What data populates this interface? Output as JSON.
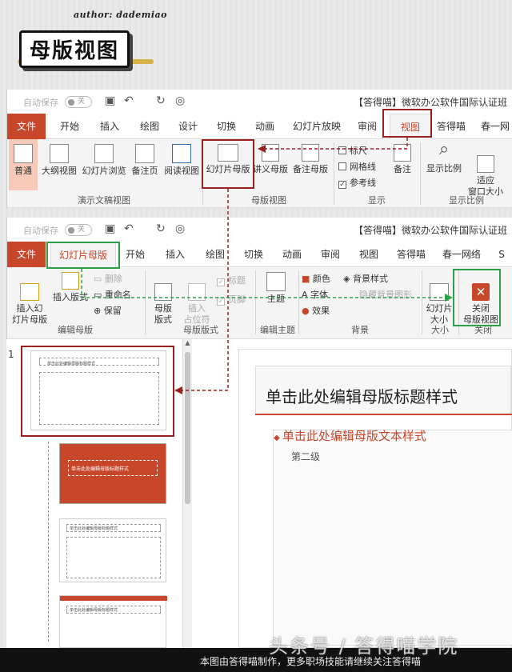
{
  "header": {
    "author": "author: dademiao",
    "title": "母版视图"
  },
  "win1": {
    "autosave": "自动保存",
    "toggle": "关",
    "title": "【答得喵】微软办公软件国际认证班",
    "tabs": [
      "文件",
      "开始",
      "插入",
      "绘图",
      "设计",
      "切换",
      "动画",
      "幻灯片放映",
      "审阅",
      "视图",
      "答得喵",
      "春一网"
    ],
    "buttons": [
      "普通",
      "大纲视图",
      "幻灯片浏览",
      "备注页",
      "阅读视图",
      "幻灯片母版",
      "讲义母版",
      "备注母版",
      "备注",
      "显示比例",
      "适应\n窗口大小"
    ],
    "checks": [
      "标尺",
      "网格线",
      "参考线"
    ],
    "groups": [
      "演示文稿视图",
      "母版视图",
      "显示",
      "显示比例"
    ]
  },
  "win2": {
    "autosave": "自动保存",
    "toggle": "关",
    "title": "【答得喵】微软办公软件国际认证班",
    "tabs": [
      "文件",
      "幻灯片母版",
      "开始",
      "插入",
      "绘图",
      "切换",
      "动画",
      "审阅",
      "视图",
      "答得喵",
      "春一网络",
      "S"
    ],
    "insert_master": "插入幻\n灯片母版",
    "insert_layout": "插入版式",
    "delete": "删除",
    "rename": "重命名",
    "preserve": "保留",
    "master_layout": "母版\n版式",
    "insert_ph": "插入\n占位符",
    "title_chk": "标题",
    "footer_chk": "页脚",
    "theme": "主题",
    "colors": "颜色",
    "fonts": "字体",
    "effects": "效果",
    "bg_style": "背景样式",
    "hide_bg": "隐藏背景图形",
    "slide_size": "幻灯片\n大小",
    "close_master": "关闭\n母版视图",
    "groups": [
      "编辑母版",
      "母版版式",
      "编辑主题",
      "背景",
      "大小",
      "关闭"
    ]
  },
  "slide": {
    "thumb_num": "1",
    "title": "单击此处编辑母版标题样式",
    "body": "单击此处编辑母版文本样式",
    "level2": "第二级",
    "thumb_titles": [
      "单击此处编辑母版标题样式",
      "单击此处编辑母版标题样式",
      "单击此处编辑母版标题样式",
      "单击此处编辑母版标题样式"
    ]
  },
  "footer": {
    "watermark": "头条号 / 答得喵学院",
    "credit": "本图由答得喵制作，更多职场技能请继续关注答得喵"
  },
  "colors": {
    "accent": "#c8472b",
    "highlight_box": "#9a1f1f",
    "green_box": "#2e9e4a"
  }
}
